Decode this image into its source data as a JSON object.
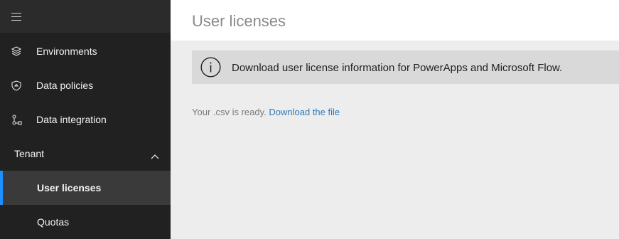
{
  "sidebar": {
    "menu_icon": "hamburger-icon",
    "items": [
      {
        "label": "Environments",
        "icon": "layers-icon"
      },
      {
        "label": "Data policies",
        "icon": "shield-icon"
      },
      {
        "label": "Data integration",
        "icon": "data-integration-icon"
      }
    ],
    "section": {
      "label": "Tenant",
      "icon": "chevron-up-icon"
    },
    "sub_items": [
      {
        "label": "User licenses",
        "active": true
      },
      {
        "label": "Quotas",
        "active": false
      }
    ],
    "accent_color": "#1e8fff"
  },
  "main": {
    "title": "User licenses",
    "info_bar": {
      "icon": "info-icon",
      "text": "Download user license information for PowerApps and Microsoft Flow."
    },
    "status": {
      "prefix": "Your .csv is ready. ",
      "link_text": "Download the file"
    }
  }
}
